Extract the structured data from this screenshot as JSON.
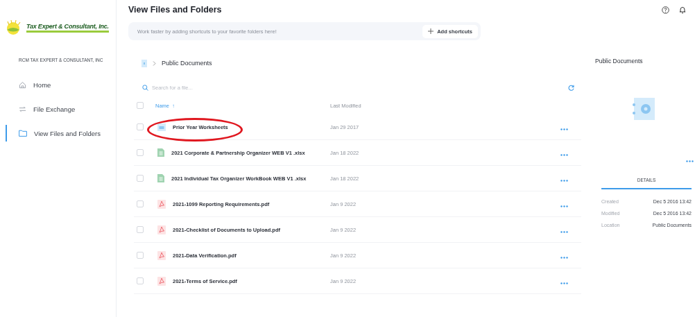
{
  "sidebar": {
    "logo_text": "Tax Expert & Consultant, Inc.",
    "company": "RCM TAX EXPERT & CONSULTANT, INC",
    "items": [
      {
        "label": "Home",
        "kind": "home",
        "selected": false
      },
      {
        "label": "File Exchange",
        "kind": "exchange",
        "selected": false
      },
      {
        "label": "View Files and Folders",
        "kind": "folder",
        "selected": true
      }
    ]
  },
  "page": {
    "title": "View Files and Folders",
    "shortcut_hint": "Work faster by adding shortcuts to your favorite folders here!",
    "shortcut_button": "Add shortcuts",
    "breadcrumb": "Public Documents",
    "search": {
      "placeholder": "Search for a file..."
    },
    "select_all_checked": false,
    "columns": [
      {
        "label": "Name",
        "sort_indicator": "↑"
      },
      {
        "label": "Last Modified"
      }
    ],
    "rows": [
      {
        "kind": "folder",
        "name": "Prior Year Worksheets",
        "modified": "Jan 29 2017",
        "checked": false,
        "annotated": true
      },
      {
        "kind": "xlsx",
        "name": "2021 Corporate & Partnership Organizer WEB V1 .xlsx",
        "modified": "Jan 18 2022",
        "checked": false,
        "annotated": false
      },
      {
        "kind": "xlsx",
        "name": "2021 Individual Tax Organizer WorkBook WEB V1 .xlsx",
        "modified": "Jan 18 2022",
        "checked": false,
        "annotated": false
      },
      {
        "kind": "pdf",
        "name": "2021-1099 Reporting Requirements.pdf",
        "modified": "Jan 9 2022",
        "checked": false,
        "annotated": false
      },
      {
        "kind": "pdf",
        "name": "2021-Checklist of Documents to Upload.pdf",
        "modified": "Jan 9 2022",
        "checked": false,
        "annotated": false
      },
      {
        "kind": "pdf",
        "name": "2021-Data Verification.pdf",
        "modified": "Jan 9 2022",
        "checked": false,
        "annotated": false
      },
      {
        "kind": "pdf",
        "name": "2021-Terms of Service.pdf",
        "modified": "Jan 9 2022",
        "checked": false,
        "annotated": false
      }
    ]
  },
  "details": {
    "title": "Public Documents",
    "tab": "DETAILS",
    "fields": [
      {
        "label": "Created",
        "value": "Dec 5 2016 13:42"
      },
      {
        "label": "Modified",
        "value": "Dec 5 2016 13:42"
      },
      {
        "label": "Location",
        "value": "Public Documents"
      }
    ]
  }
}
